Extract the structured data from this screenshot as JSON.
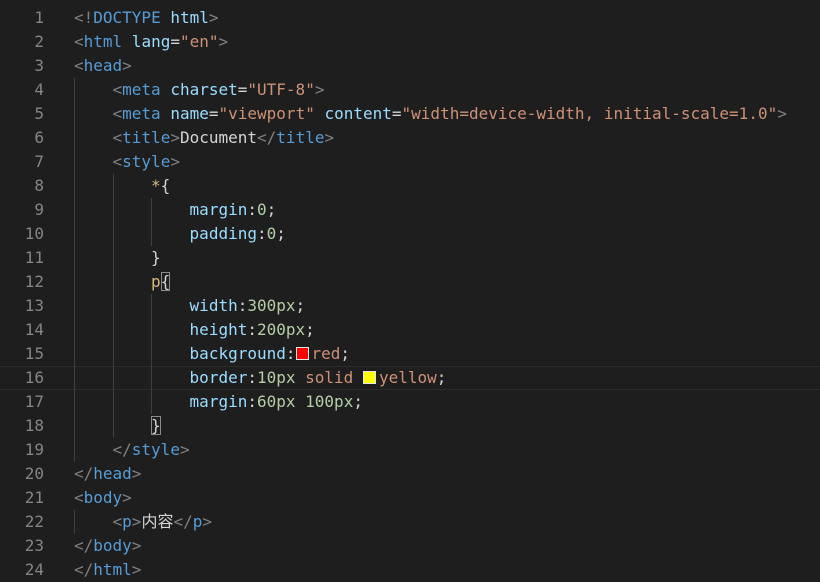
{
  "editor": {
    "current_line": 16,
    "lines": [
      {
        "n": 1,
        "indent": 0,
        "tokens": [
          {
            "t": "<!",
            "k": "punct"
          },
          {
            "t": "DOCTYPE",
            "k": "tag"
          },
          {
            "t": " html",
            "k": "attr"
          },
          {
            "t": ">",
            "k": "punct"
          }
        ]
      },
      {
        "n": 2,
        "indent": 0,
        "tokens": [
          {
            "t": "<",
            "k": "punct"
          },
          {
            "t": "html",
            "k": "tag"
          },
          {
            "t": " lang",
            "k": "attr"
          },
          {
            "t": "=",
            "k": "text"
          },
          {
            "t": "\"en\"",
            "k": "string"
          },
          {
            "t": ">",
            "k": "punct"
          }
        ]
      },
      {
        "n": 3,
        "indent": 0,
        "tokens": [
          {
            "t": "<",
            "k": "punct"
          },
          {
            "t": "head",
            "k": "tag"
          },
          {
            "t": ">",
            "k": "punct"
          }
        ]
      },
      {
        "n": 4,
        "indent": 1,
        "tokens": [
          {
            "t": "<",
            "k": "punct"
          },
          {
            "t": "meta",
            "k": "tag"
          },
          {
            "t": " charset",
            "k": "attr"
          },
          {
            "t": "=",
            "k": "text"
          },
          {
            "t": "\"UTF-8\"",
            "k": "string"
          },
          {
            "t": ">",
            "k": "punct"
          }
        ]
      },
      {
        "n": 5,
        "indent": 1,
        "tokens": [
          {
            "t": "<",
            "k": "punct"
          },
          {
            "t": "meta",
            "k": "tag"
          },
          {
            "t": " name",
            "k": "attr"
          },
          {
            "t": "=",
            "k": "text"
          },
          {
            "t": "\"viewport\"",
            "k": "string"
          },
          {
            "t": " content",
            "k": "attr"
          },
          {
            "t": "=",
            "k": "text"
          },
          {
            "t": "\"width=device-width, initial-scale=1.0\"",
            "k": "string"
          },
          {
            "t": ">",
            "k": "punct"
          }
        ]
      },
      {
        "n": 6,
        "indent": 1,
        "tokens": [
          {
            "t": "<",
            "k": "punct"
          },
          {
            "t": "title",
            "k": "tag"
          },
          {
            "t": ">",
            "k": "punct"
          },
          {
            "t": "Document",
            "k": "text"
          },
          {
            "t": "</",
            "k": "punct"
          },
          {
            "t": "title",
            "k": "tag"
          },
          {
            "t": ">",
            "k": "punct"
          }
        ]
      },
      {
        "n": 7,
        "indent": 1,
        "tokens": [
          {
            "t": "<",
            "k": "punct"
          },
          {
            "t": "style",
            "k": "tag"
          },
          {
            "t": ">",
            "k": "punct"
          }
        ]
      },
      {
        "n": 8,
        "indent": 2,
        "tokens": [
          {
            "t": "*",
            "k": "selector"
          },
          {
            "t": "{",
            "k": "text"
          }
        ]
      },
      {
        "n": 9,
        "indent": 3,
        "tokens": [
          {
            "t": "margin",
            "k": "prop"
          },
          {
            "t": ":",
            "k": "text"
          },
          {
            "t": "0",
            "k": "number"
          },
          {
            "t": ";",
            "k": "text"
          }
        ]
      },
      {
        "n": 10,
        "indent": 3,
        "tokens": [
          {
            "t": "padding",
            "k": "prop"
          },
          {
            "t": ":",
            "k": "text"
          },
          {
            "t": "0",
            "k": "number"
          },
          {
            "t": ";",
            "k": "text"
          }
        ]
      },
      {
        "n": 11,
        "indent": 2,
        "tokens": [
          {
            "t": "}",
            "k": "text"
          }
        ]
      },
      {
        "n": 12,
        "indent": 2,
        "tokens": [
          {
            "t": "p",
            "k": "tagsel"
          },
          {
            "t": "{",
            "k": "bracket"
          }
        ]
      },
      {
        "n": 13,
        "indent": 3,
        "tokens": [
          {
            "t": "width",
            "k": "prop"
          },
          {
            "t": ":",
            "k": "text"
          },
          {
            "t": "300px",
            "k": "number"
          },
          {
            "t": ";",
            "k": "text"
          }
        ]
      },
      {
        "n": 14,
        "indent": 3,
        "tokens": [
          {
            "t": "height",
            "k": "prop"
          },
          {
            "t": ":",
            "k": "text"
          },
          {
            "t": "200px",
            "k": "number"
          },
          {
            "t": ";",
            "k": "text"
          }
        ]
      },
      {
        "n": 15,
        "indent": 3,
        "tokens": [
          {
            "t": "background",
            "k": "prop"
          },
          {
            "t": ":",
            "k": "text"
          },
          {
            "t": "",
            "k": "swatch",
            "color": "#ff0000"
          },
          {
            "t": "red",
            "k": "value"
          },
          {
            "t": ";",
            "k": "text"
          }
        ]
      },
      {
        "n": 16,
        "indent": 3,
        "tokens": [
          {
            "t": "border",
            "k": "prop"
          },
          {
            "t": ":",
            "k": "text"
          },
          {
            "t": "10px",
            "k": "number"
          },
          {
            "t": " solid ",
            "k": "value"
          },
          {
            "t": "",
            "k": "swatch",
            "color": "#ffff00"
          },
          {
            "t": "yellow",
            "k": "value"
          },
          {
            "t": ";",
            "k": "text"
          }
        ]
      },
      {
        "n": 17,
        "indent": 3,
        "tokens": [
          {
            "t": "margin",
            "k": "prop"
          },
          {
            "t": ":",
            "k": "text"
          },
          {
            "t": "60px",
            "k": "number"
          },
          {
            "t": " ",
            "k": "text"
          },
          {
            "t": "100px",
            "k": "number"
          },
          {
            "t": ";",
            "k": "text"
          }
        ]
      },
      {
        "n": 18,
        "indent": 2,
        "tokens": [
          {
            "t": "}",
            "k": "bracket"
          }
        ]
      },
      {
        "n": 19,
        "indent": 1,
        "tokens": [
          {
            "t": "</",
            "k": "punct"
          },
          {
            "t": "style",
            "k": "tag"
          },
          {
            "t": ">",
            "k": "punct"
          }
        ]
      },
      {
        "n": 20,
        "indent": 0,
        "tokens": [
          {
            "t": "</",
            "k": "punct"
          },
          {
            "t": "head",
            "k": "tag"
          },
          {
            "t": ">",
            "k": "punct"
          }
        ]
      },
      {
        "n": 21,
        "indent": 0,
        "tokens": [
          {
            "t": "<",
            "k": "punct"
          },
          {
            "t": "body",
            "k": "tag"
          },
          {
            "t": ">",
            "k": "punct"
          }
        ]
      },
      {
        "n": 22,
        "indent": 1,
        "tokens": [
          {
            "t": "<",
            "k": "punct"
          },
          {
            "t": "p",
            "k": "tag"
          },
          {
            "t": ">",
            "k": "punct"
          },
          {
            "t": "内容",
            "k": "text"
          },
          {
            "t": "</",
            "k": "punct"
          },
          {
            "t": "p",
            "k": "tag"
          },
          {
            "t": ">",
            "k": "punct"
          }
        ]
      },
      {
        "n": 23,
        "indent": 0,
        "tokens": [
          {
            "t": "</",
            "k": "punct"
          },
          {
            "t": "body",
            "k": "tag"
          },
          {
            "t": ">",
            "k": "punct"
          }
        ]
      },
      {
        "n": 24,
        "indent": 0,
        "tokens": [
          {
            "t": "</",
            "k": "punct"
          },
          {
            "t": "html",
            "k": "tag"
          },
          {
            "t": ">",
            "k": "punct"
          }
        ]
      }
    ]
  },
  "theme": {
    "background": "#1e1e1e",
    "line_number": "#858585",
    "punct": "#808080",
    "tag": "#569cd6",
    "attr": "#9cdcfe",
    "string": "#ce9178",
    "text": "#d4d4d4",
    "selector": "#d7ba7d",
    "tagsel": "#d7ba7d",
    "prop": "#9cdcfe",
    "number": "#b5cea8",
    "value": "#ce9178",
    "bracket": "#d4d4d4",
    "indent_guide": "#404040"
  }
}
